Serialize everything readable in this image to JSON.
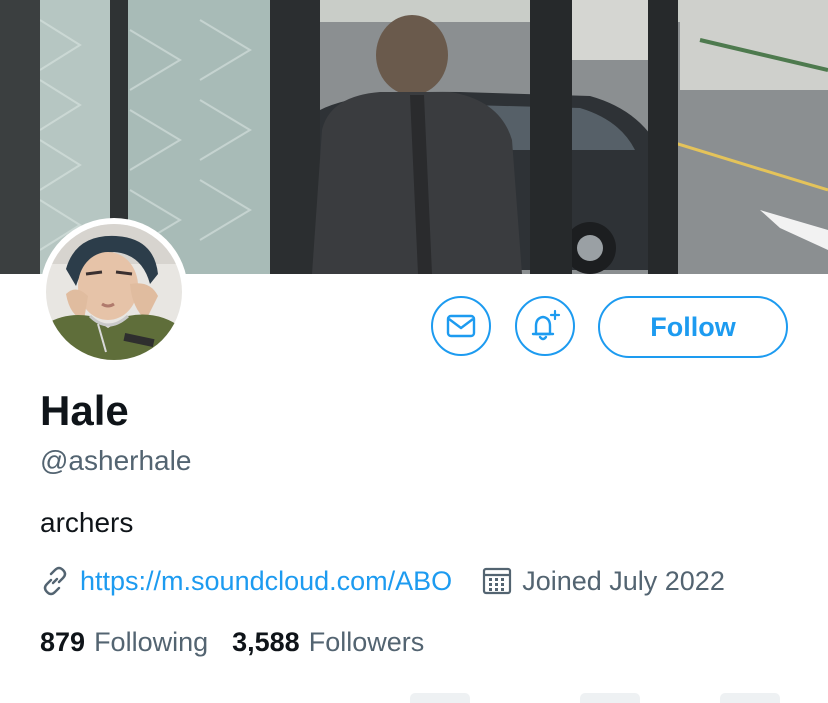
{
  "profile": {
    "display_name": "Hale",
    "handle": "@asherhale",
    "bio": "archers",
    "website": "https://m.soundcloud.com/ABO",
    "joined": "Joined July 2022",
    "following_count": "879",
    "following_label": "Following",
    "followers_count": "3,588",
    "followers_label": "Followers"
  },
  "actions": {
    "message_icon": "envelope-icon",
    "notify_icon": "bell-plus-icon",
    "follow_label": "Follow"
  },
  "icons": {
    "website": "link-icon",
    "joined": "calendar-icon"
  },
  "colors": {
    "accent": "#1d9bf0",
    "secondary_text": "#536471",
    "primary_text": "#0f1419"
  }
}
